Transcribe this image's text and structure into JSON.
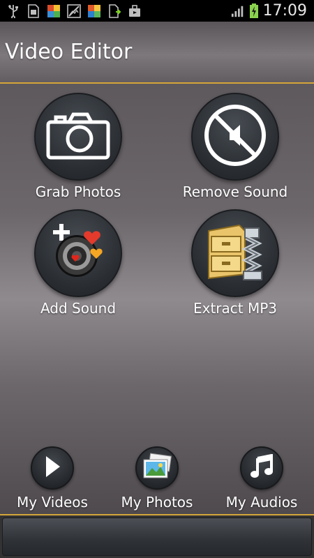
{
  "status_bar": {
    "time": "17:09",
    "icons": [
      "usb-icon",
      "sim-icon",
      "app-icon",
      "blocked-image-icon",
      "app-icon-2",
      "download-icon",
      "briefcase-icon"
    ],
    "signal_icon": "signal-icon",
    "battery_icon": "battery-charging-icon"
  },
  "header": {
    "title": "Video Editor"
  },
  "features": [
    {
      "label": "Grab Photos",
      "icon": "camera-icon"
    },
    {
      "label": "Remove Sound",
      "icon": "mute-icon"
    },
    {
      "label": "Add Sound",
      "icon": "speaker-hearts-icon"
    },
    {
      "label": "Extract MP3",
      "icon": "archive-cabinet-icon"
    }
  ],
  "bottom_nav": [
    {
      "label": "My Videos",
      "icon": "play-icon"
    },
    {
      "label": "My Photos",
      "icon": "photos-icon"
    },
    {
      "label": "My Audios",
      "icon": "music-note-icon"
    }
  ],
  "colors": {
    "accent": "#d6a53a",
    "background": "#6c676b",
    "circle": "#2a2e33"
  }
}
